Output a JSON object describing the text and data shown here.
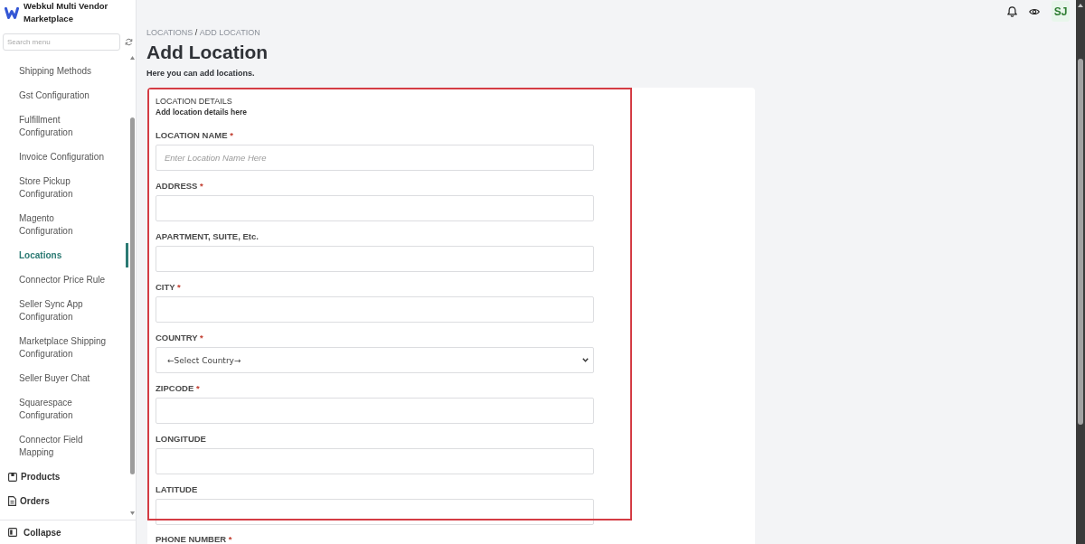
{
  "sidebar": {
    "brand": "Webkul Multi Vendor Marketplace",
    "search": {
      "placeholder": "Search menu"
    },
    "items": [
      {
        "label": "Shipping Methods",
        "selected": false
      },
      {
        "label": "Gst Configuration",
        "selected": false
      },
      {
        "label": "Fulfillment Configuration",
        "selected": false
      },
      {
        "label": "Invoice Configuration",
        "selected": false
      },
      {
        "label": "Store Pickup Configuration",
        "selected": false
      },
      {
        "label": "Magento Configuration",
        "selected": false
      },
      {
        "label": "Locations",
        "selected": true
      },
      {
        "label": "Connector Price Rule",
        "selected": false
      },
      {
        "label": "Seller Sync App Configuration",
        "selected": false
      },
      {
        "label": "Marketplace Shipping Configuration",
        "selected": false
      },
      {
        "label": "Seller Buyer Chat",
        "selected": false
      },
      {
        "label": "Squarespace Configuration",
        "selected": false
      },
      {
        "label": "Connector Field Mapping",
        "selected": false
      }
    ],
    "sections": [
      {
        "label": "Products"
      },
      {
        "label": "Orders"
      }
    ],
    "collapse": "Collapse"
  },
  "topbar": {
    "avatar": "SJ"
  },
  "breadcrumb": {
    "items": [
      "LOCATIONS",
      "ADD LOCATION"
    ],
    "separator": "/"
  },
  "page": {
    "title": "Add Location",
    "subtitle": "Here you can add locations."
  },
  "form": {
    "title": "LOCATION DETAILS",
    "subtitle": "Add location details here",
    "required_mark": "*",
    "fields": [
      {
        "kind": "text",
        "label": "LOCATION NAME",
        "required": true,
        "placeholder": "Enter Location Name Here"
      },
      {
        "kind": "text",
        "label": "ADDRESS",
        "required": true
      },
      {
        "kind": "text",
        "label": "APARTMENT, SUITE, Etc.",
        "required": false
      },
      {
        "kind": "text",
        "label": "CITY",
        "required": true
      },
      {
        "kind": "select",
        "label": "COUNTRY",
        "required": true,
        "value": "←Select Country→"
      },
      {
        "kind": "text",
        "label": "ZIPCODE",
        "required": true
      },
      {
        "kind": "text",
        "label": "LONGITUDE",
        "required": false
      },
      {
        "kind": "text",
        "label": "LATITUDE",
        "required": false
      },
      {
        "kind": "label",
        "label": "PHONE NUMBER",
        "required": true
      }
    ]
  }
}
